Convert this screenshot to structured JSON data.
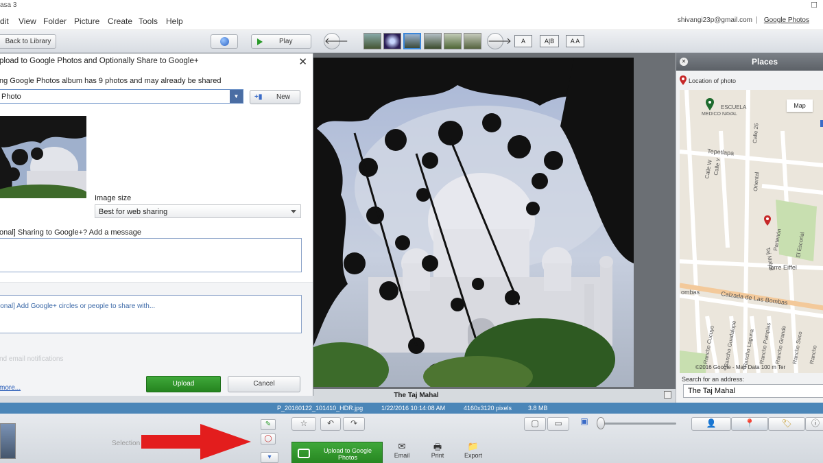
{
  "window": {
    "app_title": "asa 3",
    "maximize_glyph": "☐"
  },
  "menu": {
    "items": [
      "dit",
      "View",
      "Folder",
      "Picture",
      "Create",
      "Tools",
      "Help"
    ],
    "account": "shivangi23p@gmail.com",
    "separator": "|",
    "google_photos_link": "Google Photos"
  },
  "toolbar": {
    "back_label": "Back to Library",
    "play_label": "Play",
    "prev_glyph": "🡐",
    "next_glyph": "🡒",
    "view_modes": [
      "A",
      "A|B",
      "A A"
    ]
  },
  "dialog": {
    "title": "pload to Google Photos and Optionally Share to Google+",
    "close_glyph": "✕",
    "album_info": "ng Google Photos album has 9 photos and may already be shared",
    "album_value": "Photo",
    "new_button": "New",
    "image_size_label": "Image size",
    "image_size_value": "Best for web sharing",
    "message_label": "onal] Sharing to Google+? Add a message",
    "circles_placeholder": "ional] Add Google+ circles or people to share with...",
    "email_notifications": "nd email notifications",
    "more_link": "more...",
    "upload_button": "Upload",
    "cancel_button": "Cancel"
  },
  "viewer": {
    "caption": "The Taj Mahal"
  },
  "places": {
    "title": "Places",
    "location_label": "Location of photo",
    "map_tab": "Map",
    "map_credit": "©2016 Google - Map Data   100 m",
    "map_credit_tail": "Ter",
    "map_labels": [
      "ESCUELA",
      "MEDICO NAVAL",
      "Tepetlapa",
      "Calle W",
      "Calle Y",
      "Calle 26",
      "Oriental",
      "Taj Mahal",
      "Partenón",
      "El Escorial",
      "Torre Eiffel",
      "Calzada de Las Bombas",
      "ombas",
      "Rancho Cucuyo",
      "Rancho Guadalupe",
      "Rancho Laguna",
      "Rancho Pamplas",
      "Rancho Grande",
      "Rancho Seco",
      "Rancho"
    ],
    "search_label": "Search for an address:",
    "search_value": "The Taj Mahal"
  },
  "status": {
    "filename": "P_20160122_101410_HDR.jpg",
    "datetime": "1/22/2016 10:14:08 AM",
    "dimensions": "4160x3120 pixels",
    "filesize": "3.8 MB"
  },
  "tray": {
    "selection_label": "Selection",
    "upload_google_photos": "Upload to Google Photos",
    "actions": [
      {
        "label": "Email",
        "icon": "envelope-icon",
        "glyph": "✉"
      },
      {
        "label": "Print",
        "icon": "printer-icon",
        "glyph": "🖶"
      },
      {
        "label": "Export",
        "icon": "export-folder-icon",
        "glyph": "📁"
      }
    ]
  },
  "colors": {
    "accent_green": "#2f9a2a",
    "status_blue": "#4b86b8",
    "arrow_red": "#e31d1d"
  }
}
